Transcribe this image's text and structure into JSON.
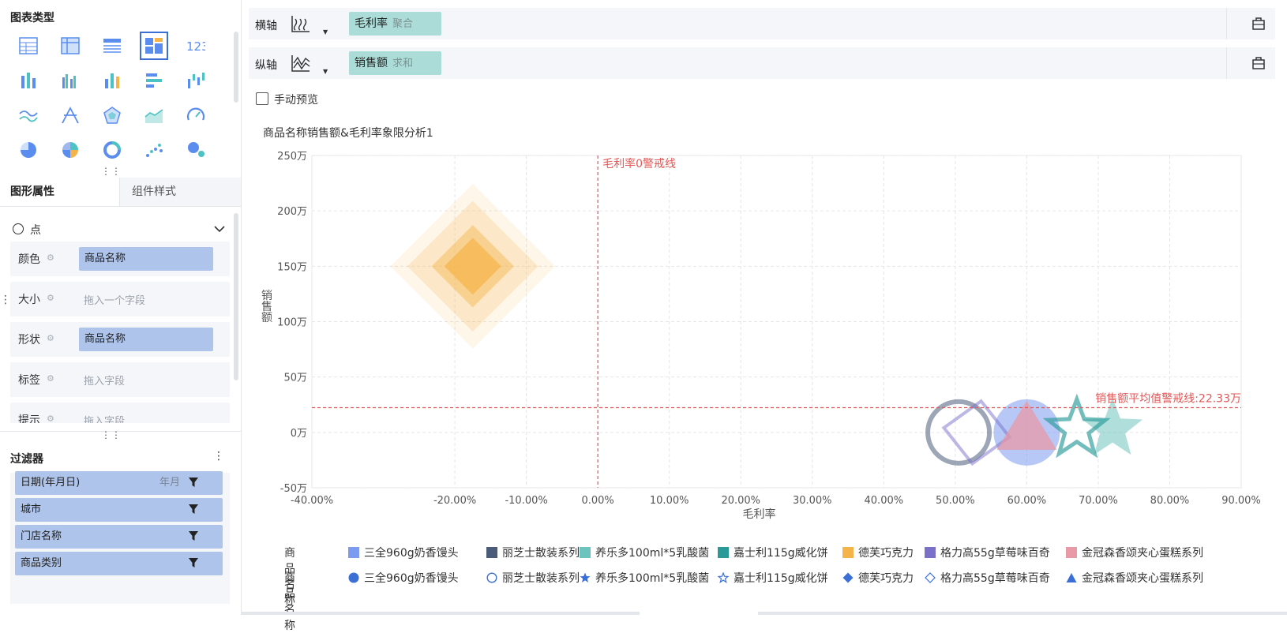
{
  "left": {
    "chart_types_title": "图表类型",
    "tab_active": "图形属性",
    "tab_inactive": "组件样式",
    "mark_type": "点",
    "props": [
      {
        "label": "颜色",
        "field": "商品名称",
        "placeholder": ""
      },
      {
        "label": "大小",
        "field": "",
        "placeholder": "拖入一个字段"
      },
      {
        "label": "形状",
        "field": "商品名称",
        "placeholder": ""
      },
      {
        "label": "标签",
        "field": "",
        "placeholder": "拖入字段"
      },
      {
        "label": "提示",
        "field": "",
        "placeholder": "拖入字段"
      }
    ],
    "filter_title": "过滤器",
    "filters": [
      {
        "label": "日期(年月日)",
        "sub": "年月"
      },
      {
        "label": "城市",
        "sub": ""
      },
      {
        "label": "门店名称",
        "sub": ""
      },
      {
        "label": "商品类别",
        "sub": ""
      }
    ]
  },
  "axes": {
    "x_label": "横轴",
    "x_field": "毛利率",
    "x_agg": "聚合",
    "y_label": "纵轴",
    "y_field": "销售额",
    "y_agg": "求和"
  },
  "manual_preview": "手动预览",
  "colors": {
    "accent": "#3b6fd6",
    "pill_blue": "#aec4ea",
    "pill_teal": "#abdcd8",
    "warn_red": "#e25757"
  },
  "chart_data": {
    "type": "scatter",
    "title": "商品名称销售额&毛利率象限分析1",
    "xlabel": "毛利率",
    "ylabel": "销售额",
    "xlim": [
      -0.4,
      0.9
    ],
    "ylim": [
      -50,
      250
    ],
    "x_ticks": [
      -0.4,
      -0.2,
      -0.1,
      0.0,
      0.1,
      0.2,
      0.3,
      0.4,
      0.5,
      0.6,
      0.7,
      0.8,
      0.9
    ],
    "x_tick_labels": [
      "-40.00%",
      "-20.00%",
      "-10.00%",
      "0.00%",
      "10.00%",
      "20.00%",
      "30.00%",
      "40.00%",
      "50.00%",
      "60.00%",
      "70.00%",
      "80.00%",
      "90.00%"
    ],
    "y_ticks": [
      -50,
      0,
      50,
      100,
      150,
      200,
      250
    ],
    "y_tick_labels": [
      "-50万",
      "0万",
      "50万",
      "100万",
      "150万",
      "200万",
      "250万"
    ],
    "grid": true,
    "ref_lines": [
      {
        "axis": "x",
        "value": 0,
        "label": "毛利率0警戒线"
      },
      {
        "axis": "y",
        "value": 22.33,
        "label": "销售额平均值警戒线:22.33万"
      }
    ],
    "points": [
      {
        "name": "三全960g奶香馒头",
        "x": 0.6,
        "y": 0,
        "shape": "circle-filled",
        "color": "#7b9af0"
      },
      {
        "name": "丽芝士散装系列",
        "x": 0.54,
        "y": 0,
        "shape": "circle-hollow",
        "color": "#4a5c7a"
      },
      {
        "name": "养乐多100ml*5乳酸菌",
        "x": 0.72,
        "y": 0,
        "shape": "star-filled",
        "color": "#6dc3bd"
      },
      {
        "name": "嘉士利115g威化饼",
        "x": 0.67,
        "y": 0,
        "shape": "star-hollow",
        "color": "#2a9a99"
      },
      {
        "name": "德芙巧克力",
        "x": -0.175,
        "y": 150,
        "shape": "diamond-filled",
        "color": "#f5b449"
      },
      {
        "name": "格力高55g草莓味百奇",
        "x": 0.53,
        "y": 0,
        "shape": "diamond-hollow",
        "color": "#7a6fc9"
      },
      {
        "name": "金冠森香颂夹心蛋糕系列",
        "x": 0.6,
        "y": 0,
        "shape": "triangle-filled",
        "color": "#e89aa7"
      }
    ],
    "legend_color_title": "商品名称",
    "legend_color": [
      {
        "name": "三全960g奶香馒头",
        "color": "#7b9af0"
      },
      {
        "name": "丽芝士散装系列",
        "color": "#4a5c7a"
      },
      {
        "name": "养乐多100ml*5乳酸菌",
        "color": "#6dc3bd"
      },
      {
        "name": "嘉士利115g威化饼",
        "color": "#2a9a99"
      },
      {
        "name": "德芙巧克力",
        "color": "#f5b449"
      },
      {
        "name": "格力高55g草莓味百奇",
        "color": "#7a6fc9"
      },
      {
        "name": "金冠森香颂夹心蛋糕系列",
        "color": "#e89aa7"
      }
    ],
    "legend_shape_title": "商品名称",
    "legend_shape": [
      {
        "name": "三全960g奶香馒头",
        "shape": "circle-filled"
      },
      {
        "name": "丽芝士散装系列",
        "shape": "circle-hollow"
      },
      {
        "name": "养乐多100ml*5乳酸菌",
        "shape": "star-filled"
      },
      {
        "name": "嘉士利115g威化饼",
        "shape": "star-hollow"
      },
      {
        "name": "德芙巧克力",
        "shape": "diamond-filled"
      },
      {
        "name": "格力高55g草莓味百奇",
        "shape": "diamond-hollow"
      },
      {
        "name": "金冠森香颂夹心蛋糕系列",
        "shape": "triangle-filled"
      }
    ]
  }
}
